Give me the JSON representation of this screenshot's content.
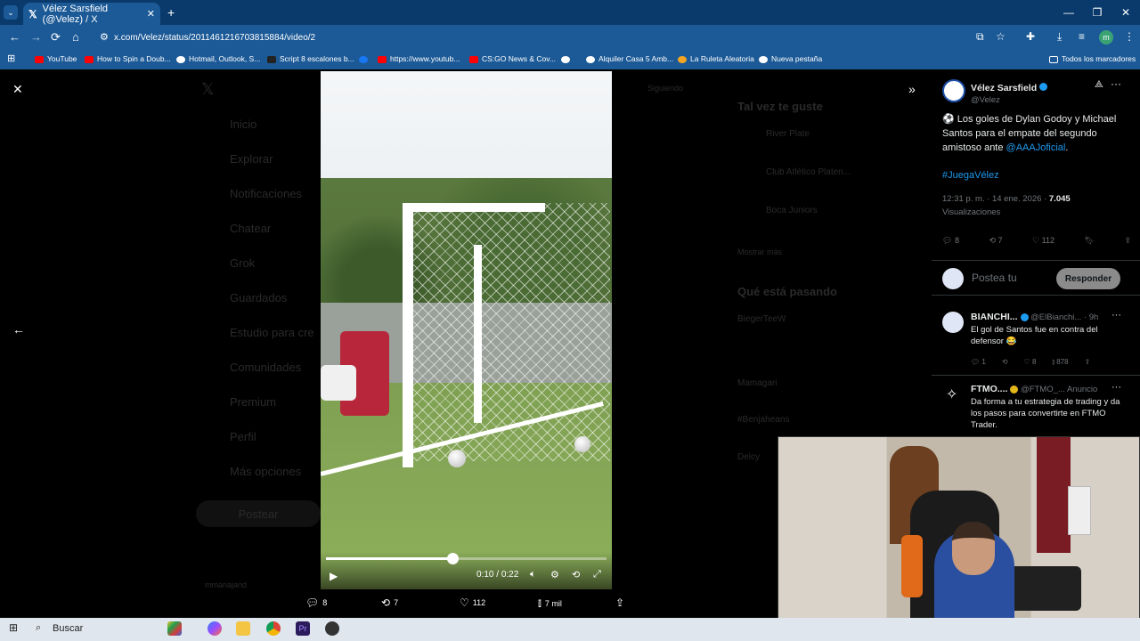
{
  "browser": {
    "tab_title": "Vélez Sarsfield (@Velez) / X",
    "url": "x.com/Velez/status/2011461216703815884/video/2",
    "profile_initial": "m",
    "bookmarks": [
      "YouTube",
      "How to Spin a Doub...",
      "Hotmail, Outlook, S...",
      "Script 8 escalones b...",
      "",
      "https://www.youtub...",
      "CS:GO News & Cov...",
      "",
      "Alquiler Casa 5 Amb...",
      "La Ruleta Aleatoria",
      "Nueva pestaña"
    ],
    "all_bookmarks": "Todos los marcadores"
  },
  "background_nav": [
    "Inicio",
    "Explorar",
    "Notificaciones",
    "Chatear",
    "Grok",
    "Guardados",
    "Estudio para cre",
    "Comunidades",
    "Premium",
    "Perfil",
    "Más opciones"
  ],
  "background_post_button": "Postear",
  "background_right": {
    "follow_label": "Siguiendo",
    "suggest_title": "Tal vez te guste",
    "suggestions": [
      "River Plate",
      "Club Atlético Platen...",
      "Boca Juniors"
    ],
    "show_more": "Mostrar más",
    "happening_title": "Qué está pasando",
    "trend_labels": [
      "BiegerTeeW",
      "Mamagari",
      "#Benjaheans",
      "Delcy"
    ],
    "user_label": "mmariajand"
  },
  "video": {
    "current_time": "0:10",
    "duration": "0:22",
    "progress": 0.45
  },
  "video_stats": {
    "replies": "8",
    "reposts": "7",
    "likes": "112",
    "views": "7 mil"
  },
  "post": {
    "author_name": "Vélez Sarsfield",
    "author_handle": "@Velez",
    "text_before": "⚽ Los goles de Dylan Godoy y Michael Santos para el empate del segundo amistoso ante ",
    "mention": "@AAAJoficial",
    "text_after": ".",
    "hashtag": "#JuegaVélez",
    "timestamp": "12:31 p. m. · 14 ene. 2026 · ",
    "views_count": "7.045",
    "views_label": "Visualizaciones",
    "replies": "8",
    "reposts": "7",
    "likes": "112"
  },
  "reply_box": {
    "placeholder": "Postea tu",
    "button": "Responder"
  },
  "comments": [
    {
      "name": "BIANCHI...",
      "handle": "@ElBianchi...",
      "time": "· 9h",
      "text": "El gol de Santos fue en contra del defensor 😂",
      "replies": "1",
      "reposts": "",
      "likes": "8",
      "views": "878"
    },
    {
      "name": "FTMO....",
      "handle": "@FTMO_...",
      "time": "Anuncio",
      "text": "Da forma a tu estrategia de trading y da los pasos para convertirte en FTMO Trader."
    }
  ],
  "taskbar": {
    "search_label": "Buscar"
  },
  "colors": {
    "accent": "#1d9bf0",
    "browser_chrome": "#1c5a97",
    "page_bg": "#000000"
  }
}
